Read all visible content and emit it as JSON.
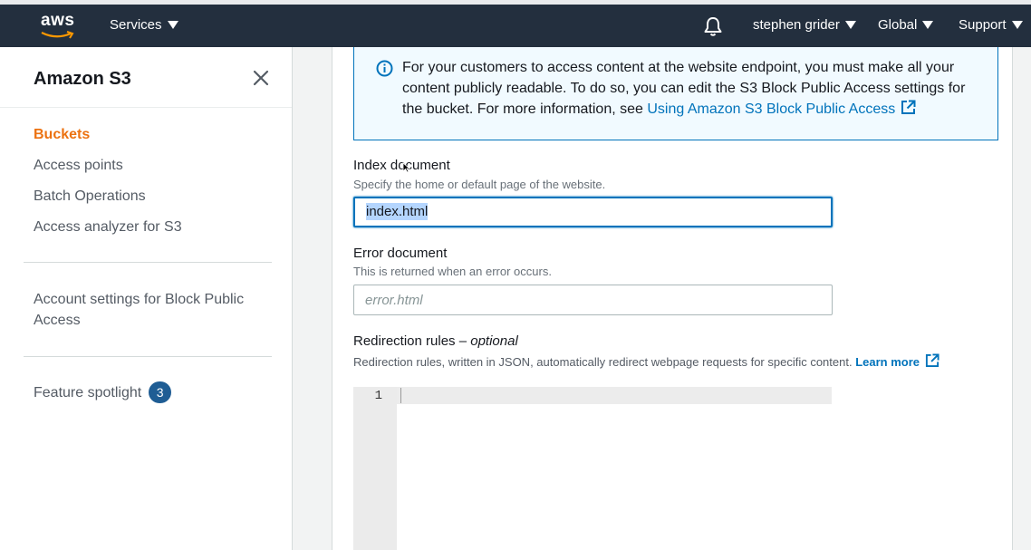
{
  "topbar": {
    "logo_text": "aws",
    "services_label": "Services",
    "user_label": "stephen grider",
    "region_label": "Global",
    "support_label": "Support"
  },
  "sidebar": {
    "title": "Amazon S3",
    "items": [
      {
        "label": "Buckets",
        "active": true
      },
      {
        "label": "Access points"
      },
      {
        "label": "Batch Operations"
      },
      {
        "label": "Access analyzer for S3"
      }
    ],
    "account_settings_line1": "Account settings for Block Public",
    "account_settings_line2": "Access",
    "feature_spotlight_label": "Feature spotlight",
    "feature_spotlight_count": "3"
  },
  "info_box": {
    "text": "For your customers to access content at the website endpoint, you must make all your content publicly readable. To do so, you can edit the S3 Block Public Access settings for the bucket. For more information, see ",
    "link_text": "Using Amazon S3 Block Public Access"
  },
  "index_document": {
    "label": "Index document",
    "description": "Specify the home or default page of the website.",
    "value": "index.html"
  },
  "error_document": {
    "label": "Error document",
    "description": "This is returned when an error occurs.",
    "placeholder": "error.html"
  },
  "redirection_rules": {
    "label": "Redirection rules – ",
    "label_optional": "optional",
    "description": "Redirection rules, written in JSON, automatically redirect webpage requests for specific content. ",
    "learn_more": "Learn more",
    "line_number": "1"
  },
  "colors": {
    "topbar_bg": "#232f3e",
    "active_nav": "#ec7211",
    "link": "#0073bb",
    "badge_bg": "#1f5d94"
  }
}
